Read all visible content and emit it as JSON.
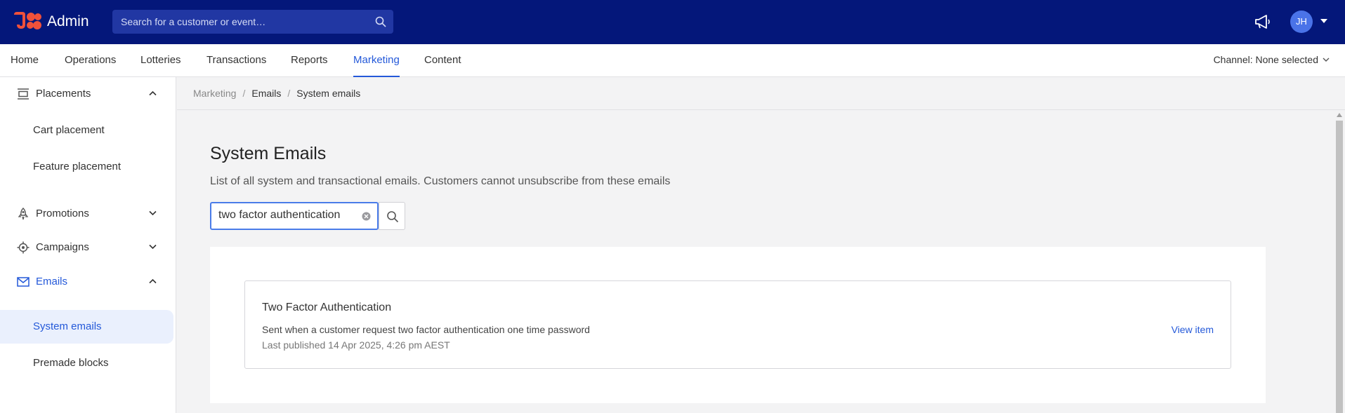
{
  "header": {
    "app_name": "Admin",
    "search_placeholder": "Search for a customer or event…",
    "avatar_initials": "JH",
    "logo_color": "#f0513a",
    "bg_color": "#04177a"
  },
  "nav": {
    "tabs": [
      {
        "label": "Home",
        "active": false
      },
      {
        "label": "Operations",
        "active": false
      },
      {
        "label": "Lotteries",
        "active": false
      },
      {
        "label": "Transactions",
        "active": false
      },
      {
        "label": "Reports",
        "active": false
      },
      {
        "label": "Marketing",
        "active": true
      },
      {
        "label": "Content",
        "active": false
      }
    ],
    "channel_label": "Channel: None selected",
    "accent_color": "#2459d9"
  },
  "sidebar": {
    "placements": {
      "label": "Placements",
      "icon": "placements-icon",
      "expanded": true
    },
    "cart_placement": "Cart placement",
    "feature_placement": "Feature placement",
    "promotions": {
      "label": "Promotions",
      "icon": "rocket-icon",
      "expanded": false
    },
    "campaigns": {
      "label": "Campaigns",
      "icon": "target-icon",
      "expanded": false
    },
    "emails": {
      "label": "Emails",
      "icon": "envelope-icon",
      "expanded": true
    },
    "system_emails": "System emails",
    "premade_blocks": "Premade blocks"
  },
  "breadcrumb": {
    "items": [
      "Marketing",
      "Emails",
      "System emails"
    ],
    "separator": "/"
  },
  "main": {
    "title": "System Emails",
    "description": "List of all system and transactional emails. Customers cannot unsubscribe from these emails",
    "search_value": "two factor authentication"
  },
  "results": [
    {
      "title": "Two Factor Authentication",
      "description": "Sent when a customer request two factor authentication one time password",
      "meta": "Last published 14 Apr 2025, 4:26 pm AEST",
      "link_label": "View item"
    }
  ]
}
